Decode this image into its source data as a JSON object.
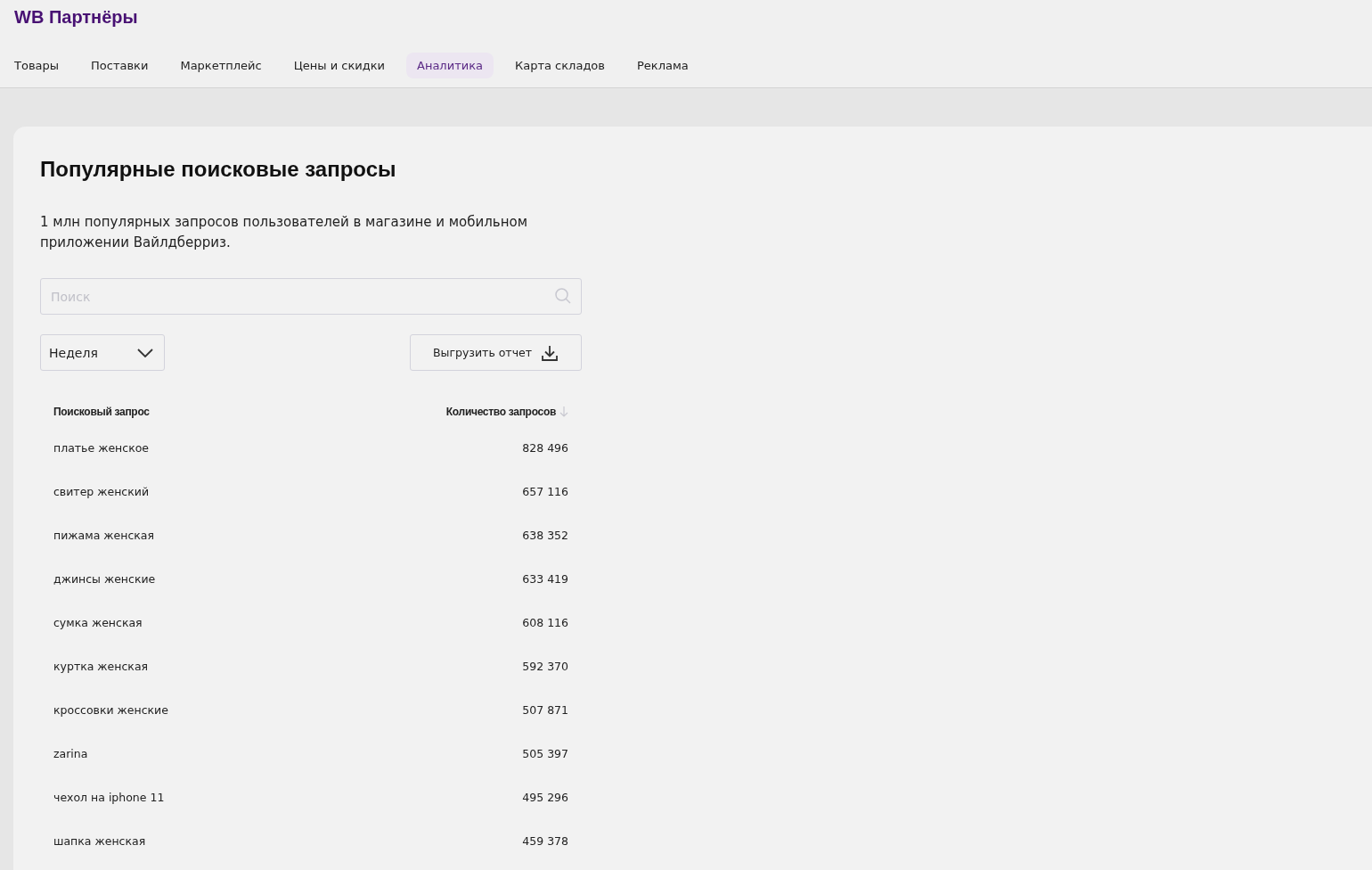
{
  "logo": "WB Партнёры",
  "nav": [
    {
      "label": "Товары",
      "selected": false
    },
    {
      "label": "Поставки",
      "selected": false
    },
    {
      "label": "Маркетплейс",
      "selected": false
    },
    {
      "label": "Цены и скидки",
      "selected": false
    },
    {
      "label": "Аналитика",
      "selected": true
    },
    {
      "label": "Карта складов",
      "selected": false
    },
    {
      "label": "Реклама",
      "selected": false
    }
  ],
  "title": "Популярные поисковые запросы",
  "description": "1 млн популярных запросов пользователей в магазине и мобильном приложении Вайлдберриз.",
  "search": {
    "placeholder": "Поиск"
  },
  "period": {
    "value": "Неделя"
  },
  "export_button": "Выгрузить отчет",
  "table": {
    "columns": [
      "Поисковый запрос",
      "Количество запросов"
    ],
    "rows": [
      [
        "платье женское",
        "828 496"
      ],
      [
        "свитер женский",
        "657 116"
      ],
      [
        "пижама женская",
        "638 352"
      ],
      [
        "джинсы женские",
        "633 419"
      ],
      [
        "сумка женская",
        "608 116"
      ],
      [
        "куртка женская",
        "592 370"
      ],
      [
        "кроссовки женские",
        "507 871"
      ],
      [
        "zarina",
        "505 397"
      ],
      [
        "чехол на iphone 11",
        "495 296"
      ],
      [
        "шапка женская",
        "459 378"
      ]
    ]
  }
}
